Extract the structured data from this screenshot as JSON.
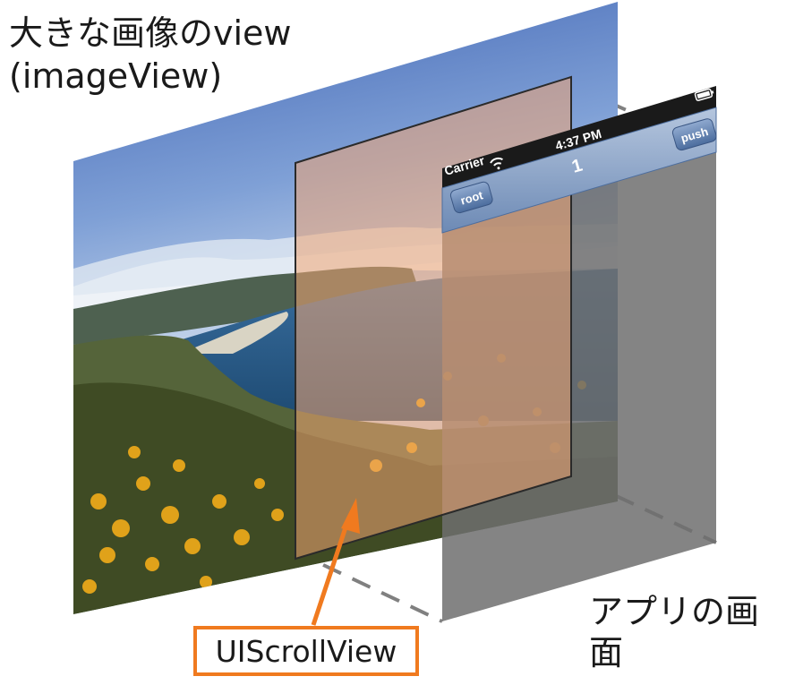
{
  "labels": {
    "image_view_title": "大きな画像のview",
    "image_view_subtitle": "(imageView)",
    "app_screen": "アプリの画面",
    "scroll_view": "UIScrollView"
  },
  "status_bar": {
    "carrier": "Carrier",
    "time": "4:37 PM"
  },
  "nav_bar": {
    "title": "1",
    "left_button": "root",
    "right_button": "push"
  },
  "colors": {
    "callout_orange": "#f07a1f",
    "scroll_view_tint": "#f3a672",
    "app_screen_gray": "#6e6e6e",
    "nav_bar_blue": "#7f9ac0",
    "dashed_line": "#808080"
  }
}
